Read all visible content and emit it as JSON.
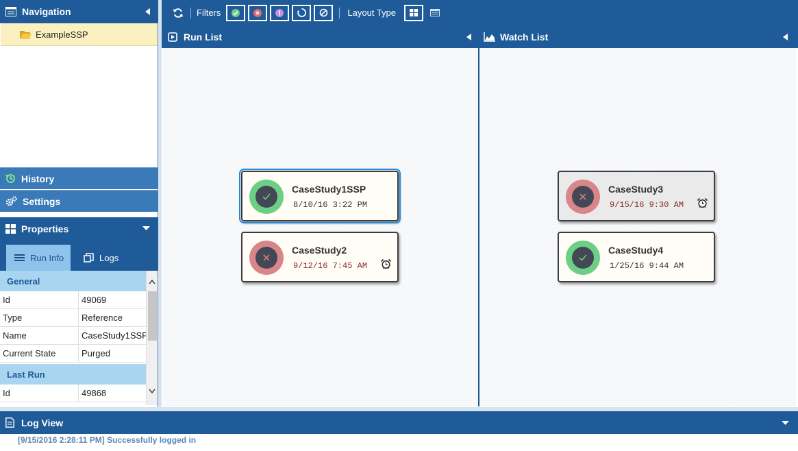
{
  "navigation": {
    "title": "Navigation",
    "tree_items": [
      {
        "label": "ExampleSSP"
      }
    ]
  },
  "history": {
    "label": "History"
  },
  "settings": {
    "label": "Settings"
  },
  "properties": {
    "title": "Properties",
    "tabs": [
      {
        "label": "Run Info",
        "active": true
      },
      {
        "label": "Logs",
        "active": false
      }
    ],
    "groups": [
      {
        "name": "General",
        "rows": [
          {
            "key": "Id",
            "value": "49069"
          },
          {
            "key": "Type",
            "value": "Reference"
          },
          {
            "key": "Name",
            "value": "CaseStudy1SSP"
          },
          {
            "key": "Current State",
            "value": "Purged"
          }
        ]
      },
      {
        "name": "Last Run",
        "rows": [
          {
            "key": "Id",
            "value": "49868"
          }
        ]
      }
    ]
  },
  "toolbar": {
    "filters_label": "Filters",
    "layout_type_label": "Layout Type",
    "filter_buttons": [
      "success-filter-icon",
      "failed-filter-icon",
      "warning-filter-icon",
      "running-filter-icon",
      "cancelled-filter-icon"
    ]
  },
  "run_list": {
    "title": "Run List",
    "cards": [
      {
        "name": "CaseStudy1SSP",
        "time": "8/10/16 3:22 PM",
        "status": "success",
        "selected": true,
        "alarm": false
      },
      {
        "name": "CaseStudy2",
        "time": "9/12/16 7:45 AM",
        "status": "failed",
        "selected": false,
        "alarm": true
      }
    ]
  },
  "watch_list": {
    "title": "Watch List",
    "cards": [
      {
        "name": "CaseStudy3",
        "time": "9/15/16 9:30 AM",
        "status": "failed",
        "selected": false,
        "alarm": true
      },
      {
        "name": "CaseStudy4",
        "time": "1/25/16 9:44 AM",
        "status": "success",
        "selected": false,
        "alarm": false
      }
    ]
  },
  "log_view": {
    "title": "Log View",
    "lines": [
      "[9/15/2016 2:28:11 PM] Successfully logged in"
    ]
  },
  "colors": {
    "header": "#1e5b98",
    "accordion": "#3a7ab8",
    "success": "#6dcf86",
    "failure": "#d9868a",
    "selection": "#2b88d8"
  }
}
